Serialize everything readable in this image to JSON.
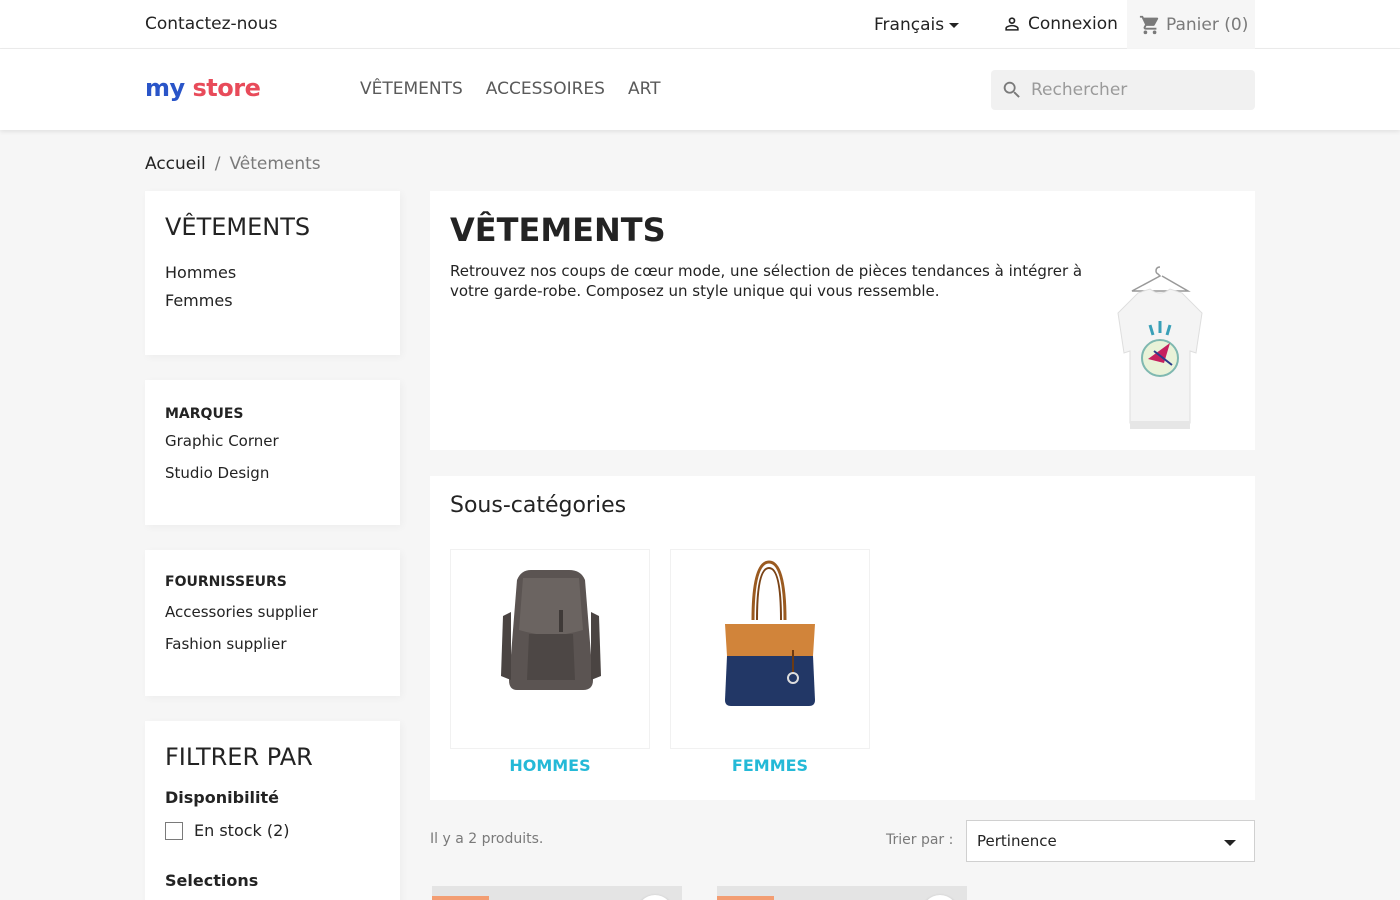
{
  "topbar": {
    "contact": "Contactez-nous",
    "language": "Français",
    "login": "Connexion",
    "cart": "Panier (0)"
  },
  "header": {
    "logo": {
      "part1": "my",
      "part2": "store"
    },
    "nav": [
      "VÊTEMENTS",
      "ACCESSOIRES",
      "ART"
    ],
    "search_placeholder": "Rechercher"
  },
  "breadcrumb": {
    "home": "Accueil",
    "separator": "/",
    "current": "Vêtements"
  },
  "sidebar": {
    "category_title": "VÊTEMENTS",
    "category_items": [
      "Hommes",
      "Femmes"
    ],
    "brands_title": "MARQUES",
    "brands": [
      "Graphic Corner",
      "Studio Design"
    ],
    "suppliers_title": "FOURNISSEURS",
    "suppliers": [
      "Accessories supplier",
      "Fashion supplier"
    ],
    "filter_title": "FILTRER PAR",
    "availability_title": "Disponibilité",
    "availability_option": "En stock (2)",
    "selections_title": "Selections"
  },
  "category": {
    "title": "VÊTEMENTS",
    "description": "Retrouvez nos coups de cœur mode, une sélection de pièces tendances à intégrer à votre garde-robe. Composez un style unique qui vous ressemble."
  },
  "subcategories": {
    "title": "Sous-catégories",
    "items": [
      "HOMMES",
      "FEMMES"
    ]
  },
  "products": {
    "count_text": "Il y a 2 produits.",
    "sort_label": "Trier par :",
    "sort_value": "Pertinence"
  },
  "colors": {
    "accent": "#24b9d7",
    "flag": "#f39d72"
  }
}
